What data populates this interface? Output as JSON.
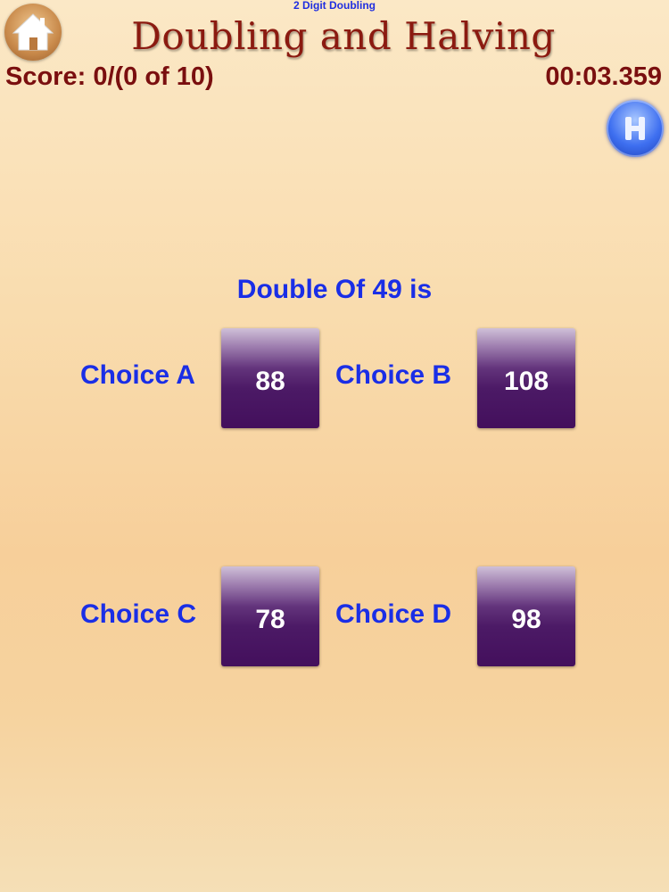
{
  "header": {
    "subtitle": "2 Digit Doubling",
    "title": "Doubling and Halving",
    "score": "Score: 0/(0 of 10)",
    "timer": "00:03.359"
  },
  "question": {
    "text": "Double Of 49  is"
  },
  "choices": [
    {
      "label": "Choice A",
      "value": "88"
    },
    {
      "label": "Choice B",
      "value": "108"
    },
    {
      "label": "Choice C",
      "value": "78"
    },
    {
      "label": "Choice D",
      "value": "98"
    }
  ],
  "icons": {
    "home": "home-icon",
    "help": "help-icon"
  },
  "colors": {
    "title": "#8b1a10",
    "score": "#7a0f0f",
    "question": "#1a2ee6",
    "answer_button": "#4c1a66"
  }
}
